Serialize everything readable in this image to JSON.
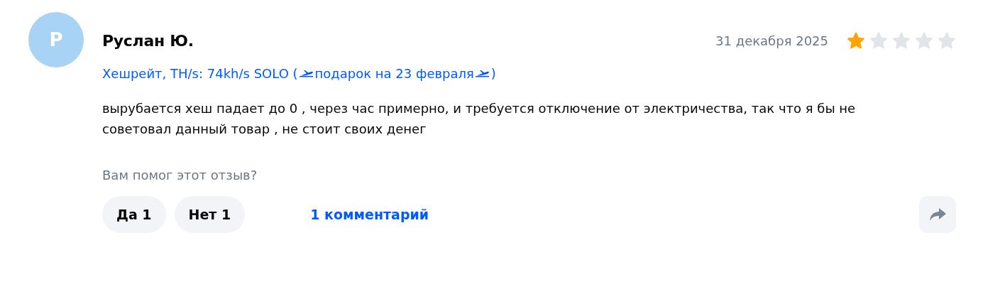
{
  "review": {
    "avatar_letter": "Р",
    "author": "Руслан Ю.",
    "date": "31 декабря 2025",
    "stars": 1,
    "variant": {
      "before": "Хешрейт, TH/s: 74kh/s SOLO (",
      "middle": "подарок на 23 февраля",
      "after": ")"
    },
    "text": "вырубается хеш падает до 0 , через час примерно, и требуется отключение от электричества, так что я бы не советовал данный товар , не стоит своих денег",
    "helpful_question": "Вам помог этот отзыв?",
    "votes": [
      {
        "label": "Да 1"
      },
      {
        "label": "Нет 1"
      }
    ],
    "comments_link": "1 комментарий"
  }
}
